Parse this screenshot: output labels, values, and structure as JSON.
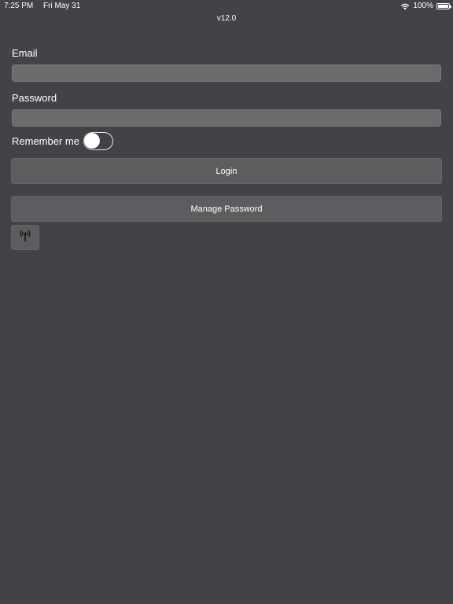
{
  "status_bar": {
    "time": "7:25 PM",
    "date": "Fri May 31",
    "battery_percent": "100%",
    "battery_level": 1.0,
    "wifi_icon": "wifi-icon",
    "battery_icon": "battery-icon"
  },
  "app": {
    "version": "v12.0"
  },
  "form": {
    "email_label": "Email",
    "email_value": "",
    "password_label": "Password",
    "password_value": "",
    "remember_label": "Remember me",
    "remember_on": false
  },
  "buttons": {
    "login_label": "Login",
    "manage_password_label": "Manage Password",
    "antenna_icon": "antenna-icon"
  },
  "colors": {
    "background": "#434246",
    "input_background": "#6b6b6e",
    "button_background": "#5d5d60",
    "text": "#ffffff"
  }
}
